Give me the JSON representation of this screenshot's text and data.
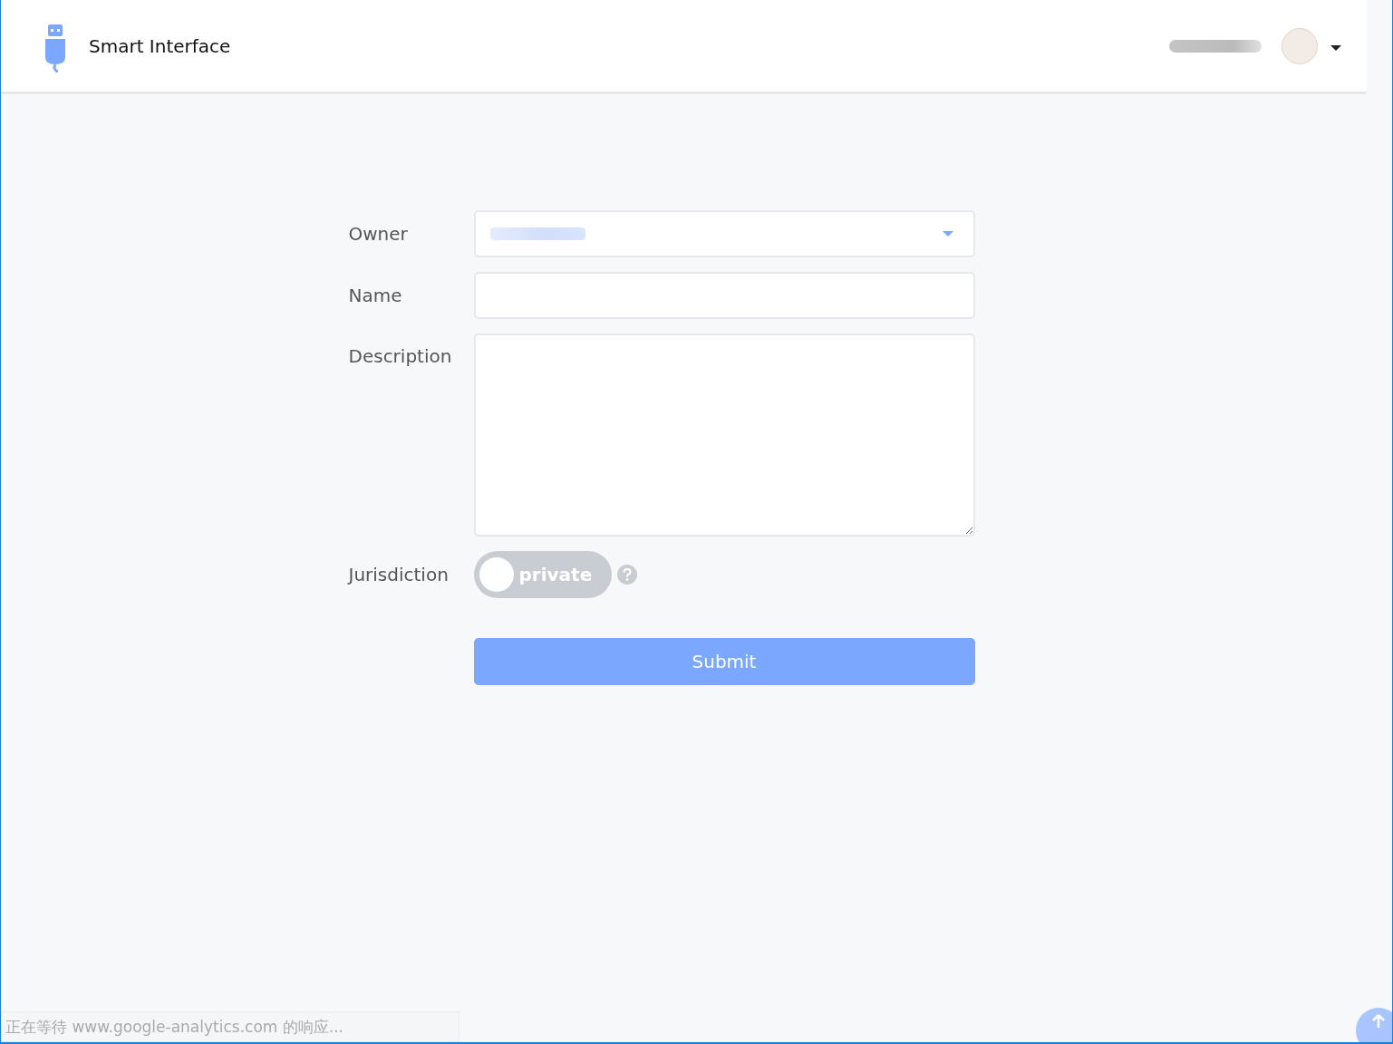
{
  "header": {
    "title": "Smart Interface"
  },
  "form": {
    "fields": [
      {
        "kind": "select",
        "label": "Owner"
      },
      {
        "kind": "input",
        "label": "Name"
      },
      {
        "kind": "textarea",
        "label": "Description"
      },
      {
        "kind": "switch",
        "label": "Jurisdiction",
        "switch_text": "private",
        "on": false
      }
    ],
    "submit": "Submit"
  },
  "status_bar": {
    "text": "正在等待 www.google-analytics.com 的响应..."
  }
}
